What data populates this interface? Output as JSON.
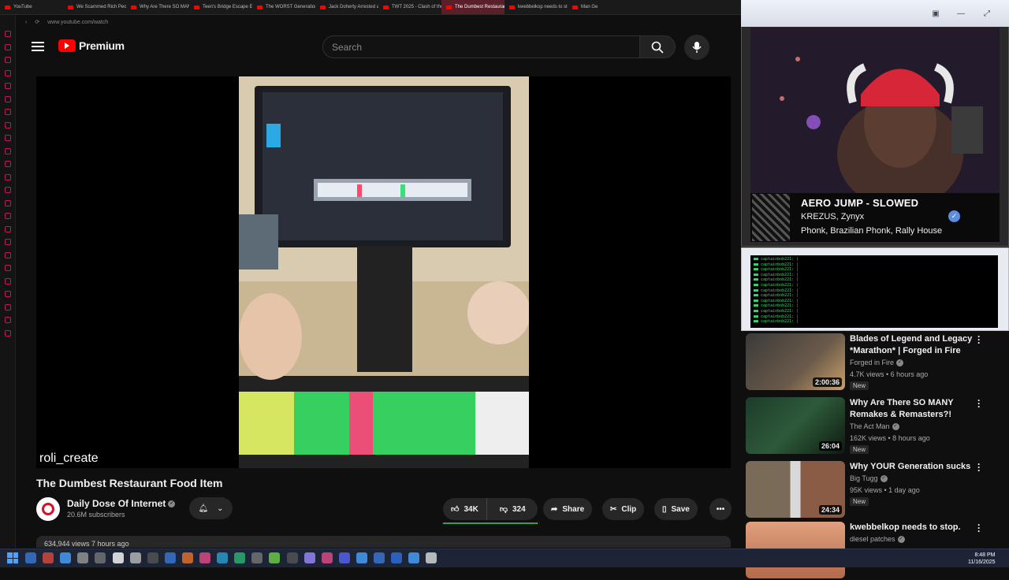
{
  "browser": {
    "tabs": [
      {
        "label": "YouTube",
        "active": false
      },
      {
        "label": "We Scammed Rich People",
        "active": false
      },
      {
        "label": "Why Are There SO MANY",
        "active": false
      },
      {
        "label": "Teen's Bridge Escape Ends",
        "active": false
      },
      {
        "label": "The WORST Generation",
        "active": false
      },
      {
        "label": "Jack Doherty Arrested at",
        "active": false
      },
      {
        "label": "TWT 2025 - Clash of the",
        "active": false
      },
      {
        "label": "The Dumbest Restaurant",
        "active": true
      },
      {
        "label": "kwebbelkop needs to sto",
        "active": false
      },
      {
        "label": "Man Ge",
        "active": false
      }
    ],
    "url": "www.youtube.com/watch"
  },
  "header": {
    "logo_text": "Premium",
    "search_placeholder": "Search"
  },
  "player": {
    "watermark": "roli_create"
  },
  "video": {
    "title": "The Dumbest Restaurant Food Item",
    "channel": "Daily Dose Of Internet",
    "subscribers": "20.6M subscribers",
    "likes": "34K",
    "dislikes": "324",
    "like_ratio": 0.99,
    "share_label": "Share",
    "clip_label": "Clip",
    "save_label": "Save",
    "views_line": "634,944 views  7 hours ago"
  },
  "now_playing": {
    "title": "AERO JUMP - SLOWED",
    "artist": "KREZUS, Zynyx",
    "genres": "Phonk, Brazilian Phonk, Rally House"
  },
  "chat": {
    "lines": [
      "captainbob221: |",
      "captainbob221: |",
      "captainbob221: |",
      "captainbob221: |",
      "captainbob221: |",
      "captainbob221: |",
      "captainbob221: |",
      "captainbob221: |",
      "captainbob221: |",
      "captainbob221: |",
      "captainbob221: |",
      "captainbob221: |",
      "captainbob221: |"
    ]
  },
  "suggestions": [
    {
      "title": "Blades of Legend and Legacy *Marathon* | Forged in Fire",
      "channel": "Forged in Fire",
      "meta": "4.7K views • 6 hours ago",
      "badge": "New",
      "duration": "2:00:36",
      "thumb": "forged-in-fire"
    },
    {
      "title": "Why Are There SO MANY Remakes & Remasters?!",
      "channel": "The Act Man",
      "meta": "162K views • 8 hours ago",
      "badge": "New",
      "duration": "26:04",
      "thumb": "remakes"
    },
    {
      "title": "Why YOUR Generation sucks",
      "channel": "Big Tugg",
      "meta": "95K views • 1 day ago",
      "badge": "New",
      "duration": "24:34",
      "thumb": "vs"
    },
    {
      "title": "kwebbelkop needs to stop.",
      "channel": "diesel patches",
      "meta": "",
      "badge": "",
      "duration": "",
      "thumb": "face"
    }
  ],
  "taskbar": {
    "time": "8:48 PM",
    "date": "11/16/2025"
  },
  "colors": {
    "accent": "#ff0000",
    "like_bar": "#2ba640",
    "chat_text": "#39d86b"
  }
}
